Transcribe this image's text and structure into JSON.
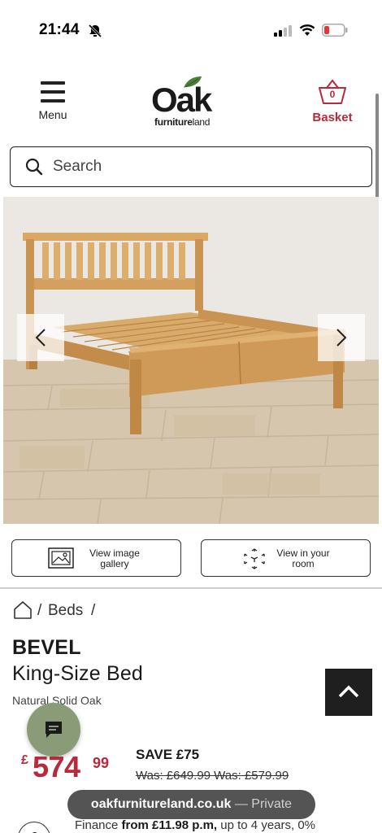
{
  "status": {
    "time": "21:44"
  },
  "header": {
    "menu_label": "Menu",
    "logo_main": "Oak",
    "logo_sub_bold": "furniture",
    "logo_sub_rest": "land",
    "basket_count": "0",
    "basket_label": "Basket"
  },
  "search": {
    "placeholder": "Search"
  },
  "gallery": {
    "view_gallery_label": "View image gallery",
    "view_room_label": "View in your room"
  },
  "breadcrumb": {
    "separator": "/",
    "category": "Beds"
  },
  "product": {
    "name_line1": "BEVEL",
    "name_line2": "King-Size Bed",
    "finish": "Natural Solid Oak",
    "price_currency": "£",
    "price_whole": "574",
    "price_pence": "99",
    "save_text": "SAVE £75",
    "was_text": "Was: £649.99 Was: £579.99",
    "finance_prefix": "Finance ",
    "finance_bold": "from £11.98 p.m,",
    "finance_rest": " up to 4 years, 0%"
  },
  "browser": {
    "domain": "oakfurnitureland.co.uk",
    "private_label": " — Private"
  },
  "colors": {
    "brand_red": "#b8293c",
    "chat_green": "#8a9b78",
    "dark": "#1f1f1f"
  }
}
